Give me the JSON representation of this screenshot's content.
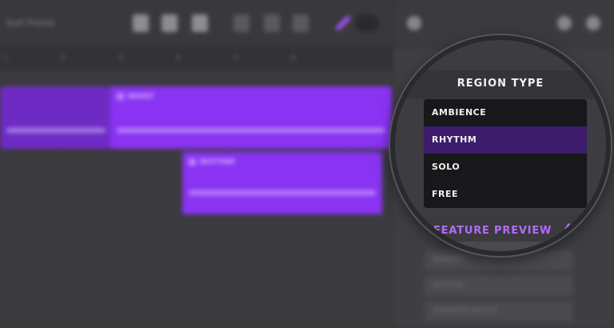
{
  "editor": {
    "project_name": "Sort Frome",
    "ruler_ticks": [
      "1",
      "2",
      "3",
      "4",
      "5",
      "6"
    ],
    "regions": [
      {
        "label": "RHOLT"
      },
      {
        "label": "RHYTHM"
      }
    ]
  },
  "side_panel": {
    "list_items": [
      "AMBIENT",
      "RHYTHM",
      "SOUNDTR SELECT"
    ]
  },
  "region_type_menu": {
    "title": "REGION TYPE",
    "options": [
      "AMBIENCE",
      "RHYTHM",
      "SOLO",
      "FREE"
    ],
    "selected": "RHYTHM"
  },
  "feature_preview": {
    "label": "FEATURE PREVIEW"
  },
  "colors": {
    "accent": "#8a33f2",
    "selected_bg": "#3c1c6b",
    "feature_text": "#b26cff"
  }
}
